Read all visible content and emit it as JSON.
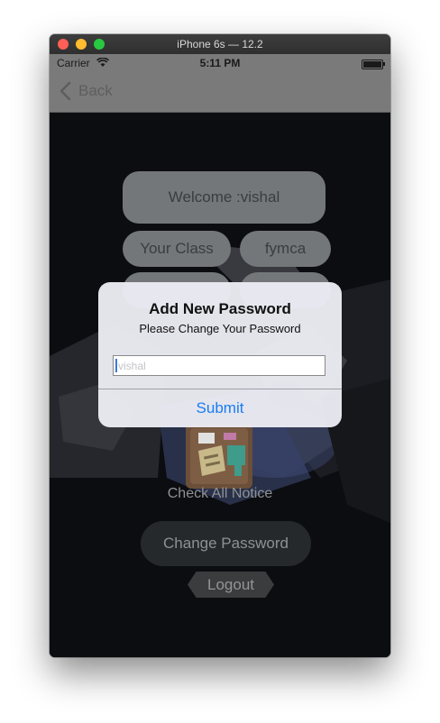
{
  "window": {
    "title": "iPhone 6s — 12.2"
  },
  "status_bar": {
    "carrier": "Carrier",
    "time": "5:11 PM"
  },
  "nav": {
    "back_label": "Back"
  },
  "app": {
    "welcome_label": "Welcome :vishal",
    "class_label": "Your Class",
    "class_value": "fymca",
    "notice_label": "Check All Notice",
    "change_password_label": "Change Password",
    "logout_label": "Logout"
  },
  "alert": {
    "title": "Add New Password",
    "message": "Please Change Your Password",
    "input_value": "",
    "input_placeholder": "vishal",
    "submit_label": "Submit"
  },
  "colors": {
    "accent": "#1a7cf5",
    "traffic_red": "#fe5f57",
    "traffic_yellow": "#febc2e",
    "traffic_green": "#28c840"
  }
}
